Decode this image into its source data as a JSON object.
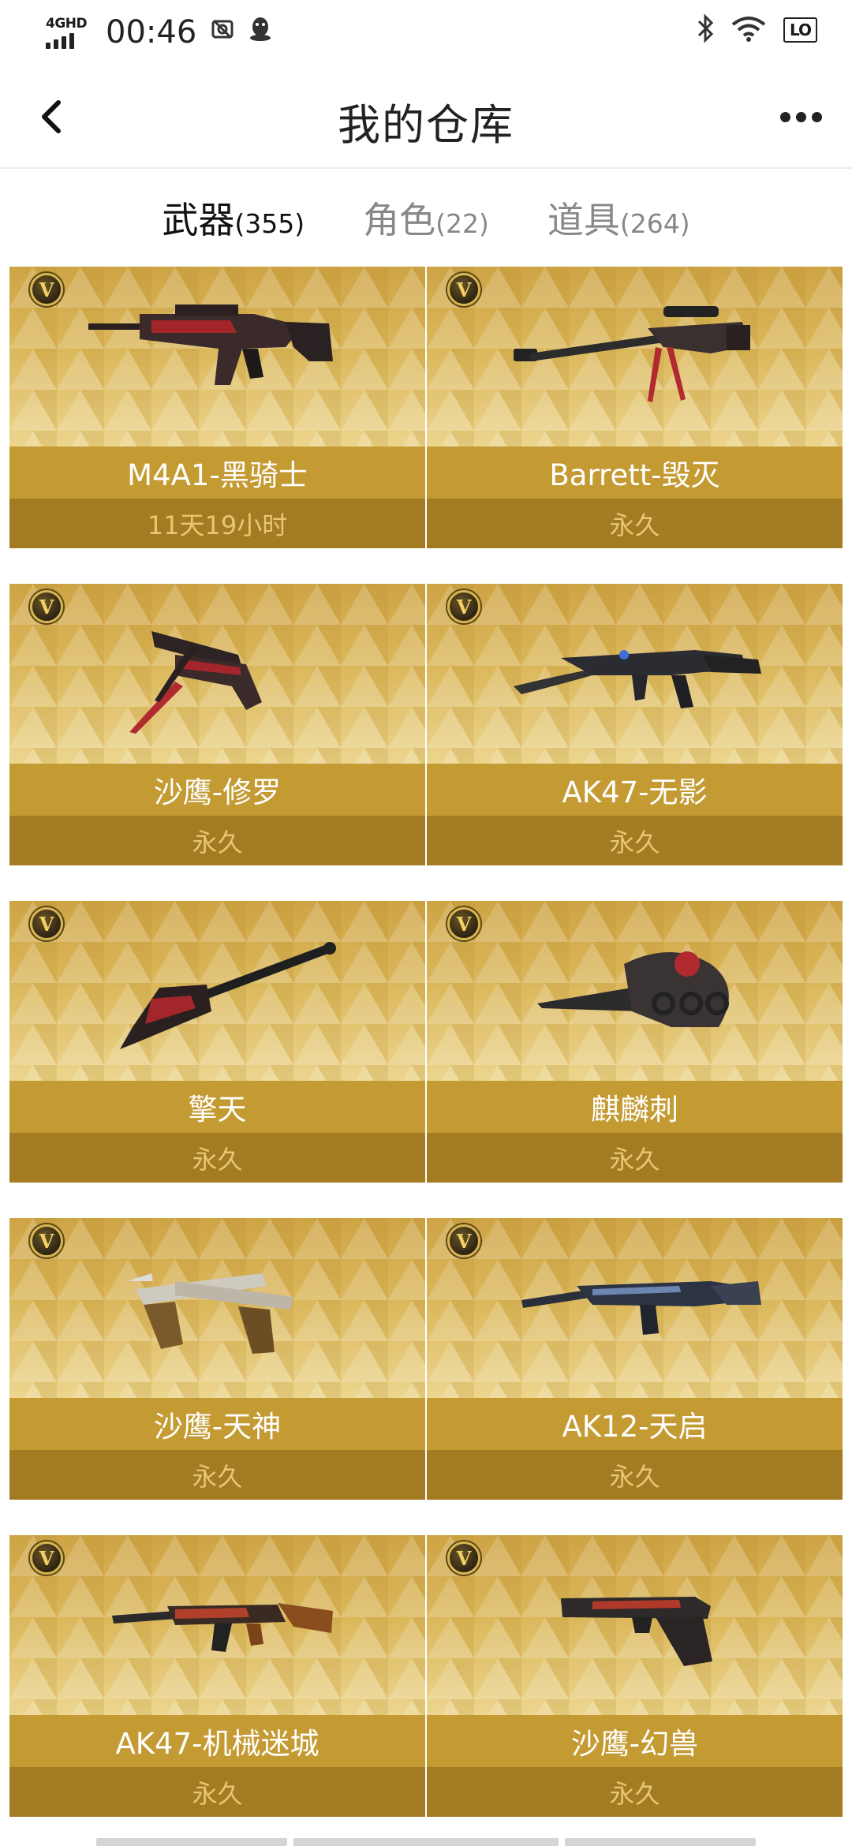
{
  "status_bar": {
    "network": "4GHD",
    "time": "00:46",
    "badge": "LO"
  },
  "header": {
    "title": "我的仓库"
  },
  "tabs": [
    {
      "label": "武器",
      "count": "(355)",
      "active": true
    },
    {
      "label": "角色",
      "count": "(22)",
      "active": false
    },
    {
      "label": "道具",
      "count": "(264)",
      "active": false
    }
  ],
  "items": [
    {
      "name": "M4A1-黑骑士",
      "duration": "11天19小时",
      "weapon_icon": "m4a1-rifle-icon"
    },
    {
      "name": "Barrett-毁灭",
      "duration": "永久",
      "weapon_icon": "sniper-rifle-icon"
    },
    {
      "name": "沙鹰-修罗",
      "duration": "永久",
      "weapon_icon": "desert-eagle-pistol-icon"
    },
    {
      "name": "AK47-无影",
      "duration": "永久",
      "weapon_icon": "ak47-rifle-icon"
    },
    {
      "name": "擎天",
      "duration": "永久",
      "weapon_icon": "spade-melee-icon"
    },
    {
      "name": "麒麟刺",
      "duration": "永久",
      "weapon_icon": "knuckle-blade-icon"
    },
    {
      "name": "沙鹰-天神",
      "duration": "永久",
      "weapon_icon": "dual-pistols-icon"
    },
    {
      "name": "AK12-天启",
      "duration": "永久",
      "weapon_icon": "ak12-rifle-icon"
    },
    {
      "name": "AK47-机械迷城",
      "duration": "永久",
      "weapon_icon": "ak47-wood-rifle-icon"
    },
    {
      "name": "沙鹰-幻兽",
      "duration": "永久",
      "weapon_icon": "pistol-icon"
    }
  ],
  "colors": {
    "card_gold": "#dbb85c",
    "name_bar": "#c49a33",
    "duration_bar": "#a37b22",
    "duration_text": "#e7c771"
  }
}
